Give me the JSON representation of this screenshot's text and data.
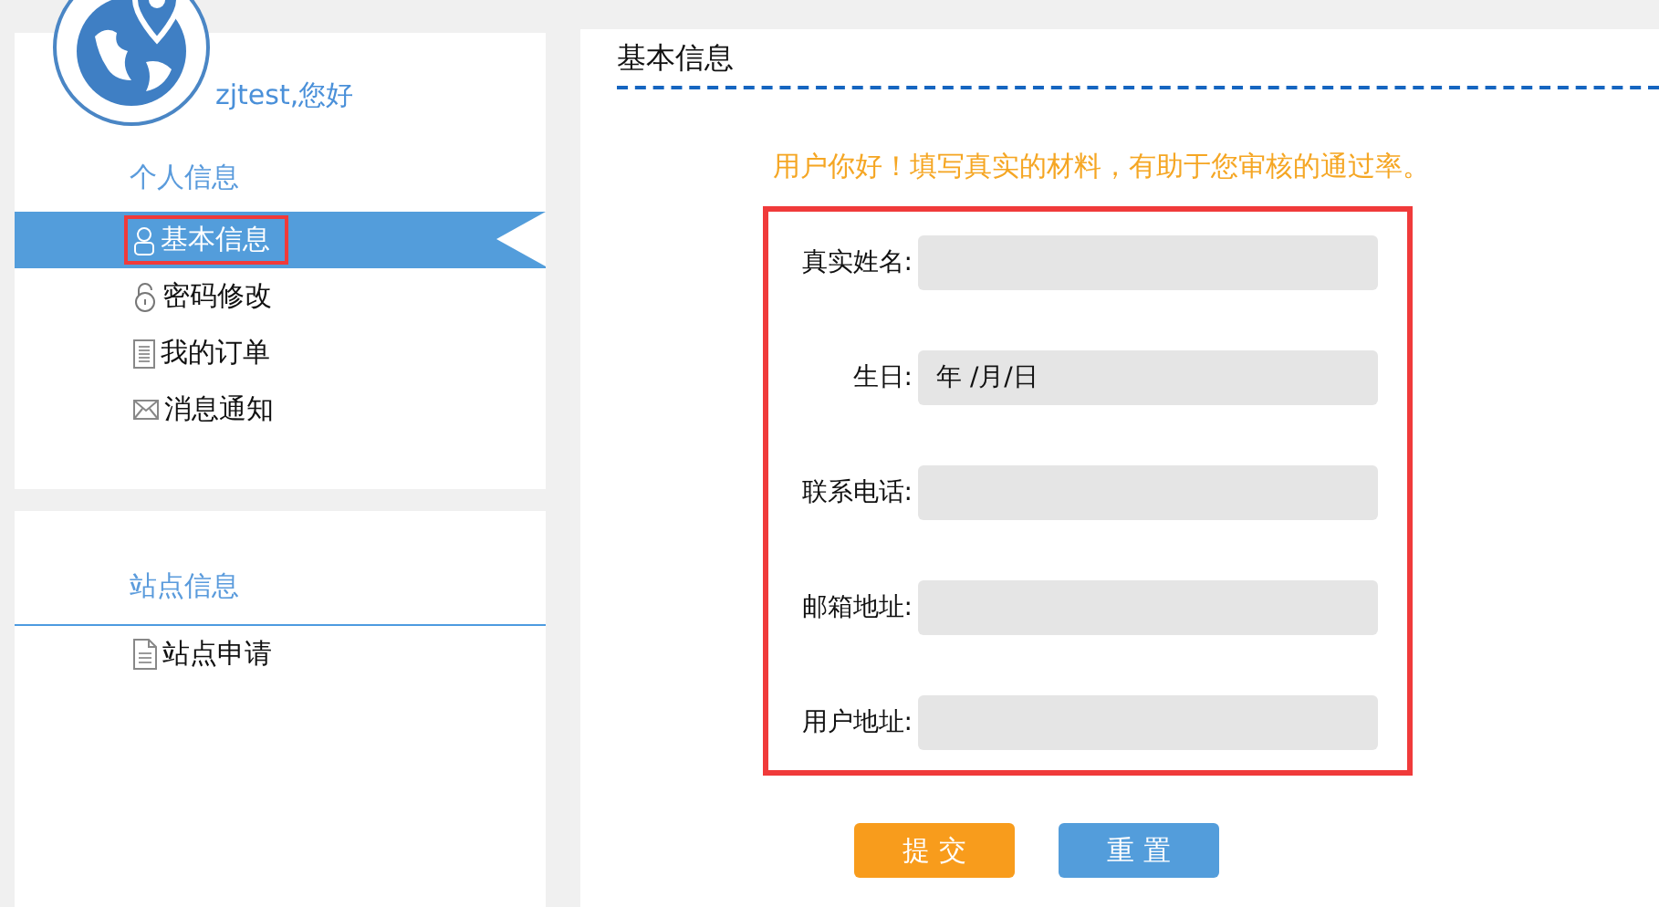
{
  "user": {
    "greeting": "zjtest,您好"
  },
  "sidebar": [
    {
      "heading": "个人信息",
      "items": [
        {
          "label": "基本信息",
          "kind": "person",
          "selected": true,
          "highlighted": true
        },
        {
          "label": "密码修改",
          "kind": "lock",
          "selected": false,
          "highlighted": false
        },
        {
          "label": "我的订单",
          "kind": "list",
          "selected": false,
          "highlighted": false
        },
        {
          "label": "消息通知",
          "kind": "mail",
          "selected": false,
          "highlighted": false
        }
      ]
    },
    {
      "heading": "站点信息",
      "items": [
        {
          "label": "站点申请",
          "kind": "document",
          "selected": false,
          "highlighted": false
        }
      ]
    }
  ],
  "content": {
    "title": "基本信息",
    "notice": "用户你好！填写真实的材料，有助于您审核的通过率。",
    "form": {
      "highlighted": true,
      "fields": [
        {
          "label": "真实姓名:"
        },
        {
          "label": "生日:",
          "placeholder": "年 /月/日"
        },
        {
          "label": "联系电话:"
        },
        {
          "label": "邮箱地址:"
        },
        {
          "label": "用户地址:"
        }
      ]
    },
    "buttons": [
      {
        "label": "提 交",
        "kind": "primary"
      },
      {
        "label": "重 置",
        "kind": "secondary"
      }
    ]
  }
}
